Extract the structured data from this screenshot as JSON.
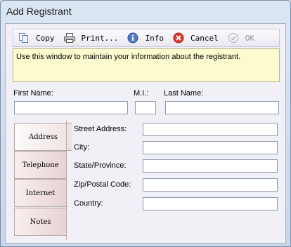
{
  "window": {
    "title": "Add Registrant"
  },
  "toolbar": {
    "copy_label": "Copy",
    "print_label": "Print...",
    "info_label": "Info",
    "cancel_label": "Cancel",
    "ok_label": "OK"
  },
  "info_text": "Use this window to maintain your information about the registrant.",
  "name": {
    "first_label": "First Name:",
    "mi_label": "M.I.:",
    "last_label": "Last Name:",
    "first_value": "",
    "mi_value": "",
    "last_value": ""
  },
  "tabs": [
    {
      "label": "Address"
    },
    {
      "label": "Telephone"
    },
    {
      "label": "Internet"
    },
    {
      "label": "Notes"
    }
  ],
  "address": {
    "street_label": "Street Address:",
    "city_label": "City:",
    "state_label": "State/Province:",
    "zip_label": "Zip/Postal Code:",
    "country_label": "Country:",
    "street_value": "",
    "city_value": "",
    "state_value": "",
    "zip_value": "",
    "country_value": ""
  }
}
